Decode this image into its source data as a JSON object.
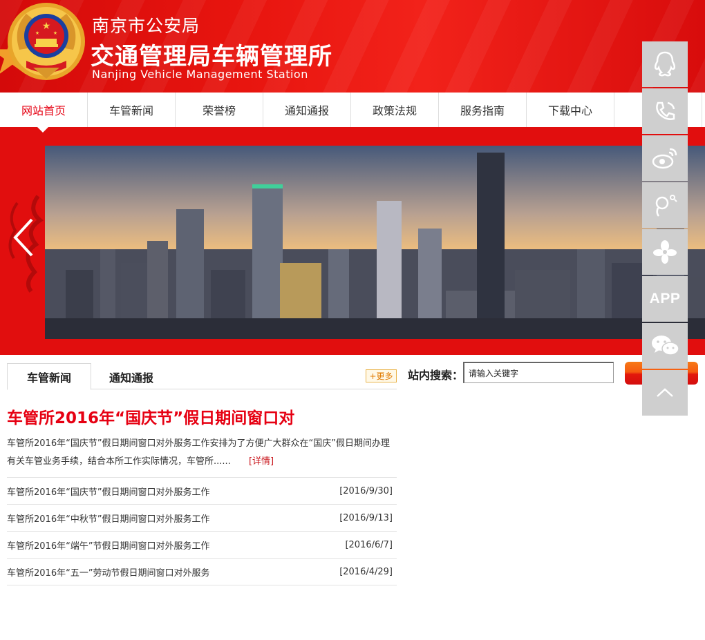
{
  "header": {
    "title_small": "南京市公安局",
    "title_big": "交通管理局车辆管理所",
    "title_en": "Nanjing Vehicle Management Station"
  },
  "nav": {
    "items": [
      {
        "label": "网站首页",
        "active": true
      },
      {
        "label": "车管新闻",
        "active": false
      },
      {
        "label": "荣誉榜",
        "active": false
      },
      {
        "label": "通知通报",
        "active": false
      },
      {
        "label": "政策法规",
        "active": false
      },
      {
        "label": "服务指南",
        "active": false
      },
      {
        "label": "下载中心",
        "active": false
      },
      {
        "label": "",
        "active": false
      }
    ]
  },
  "news": {
    "tabs": [
      "车管新闻",
      "通知通报"
    ],
    "more_label": "+更多",
    "headline": "车管所2016年“国庆节”假日期间窗口对",
    "summary": "车管所2016年“国庆节”假日期间窗口对外服务工作安排为了方便广大群众在“国庆”假日期间办理有关车管业务手续，结合本所工作实际情况，车管所......",
    "detail_label": "[详情]",
    "items": [
      {
        "title": "车管所2016年“国庆节”假日期间窗口对外服务工作",
        "date": "[2016/9/30]"
      },
      {
        "title": "车管所2016年“中秋节”假日期间窗口对外服务工作",
        "date": "[2016/9/13]"
      },
      {
        "title": "车管所2016年“端午”节假日期间窗口对外服务工作",
        "date": "[2016/6/7]"
      },
      {
        "title": "车管所2016年“五一”劳动节假日期间窗口对外服务",
        "date": "[2016/4/29]"
      }
    ]
  },
  "search": {
    "label": "站内搜索：",
    "value": "请输入关键字"
  },
  "sidebar": {
    "icons": [
      "qq-icon",
      "phone-icon",
      "weibo-icon",
      "tencent-weibo-icon",
      "flower-icon",
      "app-icon",
      "wechat-icon",
      "back-to-top-icon"
    ],
    "app_label": "APP"
  },
  "colors": {
    "brand_red": "#e60012",
    "header_red": "#e8150f",
    "sidebar_gray": "#cfcfcf"
  }
}
